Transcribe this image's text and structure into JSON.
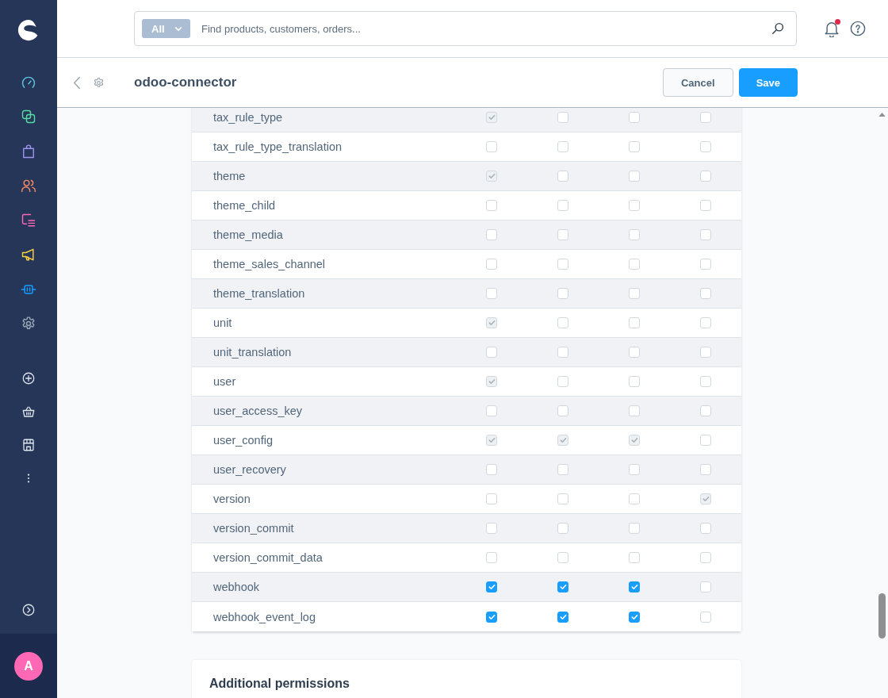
{
  "search": {
    "scope": "All",
    "placeholder": "Find products, customers, orders..."
  },
  "notifications": {
    "unread": true
  },
  "page_header": {
    "title": "odoo-connector",
    "buttons": [
      {
        "label": "Cancel",
        "kind": "secondary"
      },
      {
        "label": "Save",
        "kind": "primary"
      }
    ]
  },
  "table": {
    "rows": [
      {
        "name": "tax_rule_type",
        "permissions": [
          {
            "checked": true,
            "disabled": true
          },
          {
            "checked": false,
            "disabled": false
          },
          {
            "checked": false,
            "disabled": false
          },
          {
            "checked": false,
            "disabled": false
          }
        ]
      },
      {
        "name": "tax_rule_type_translation",
        "permissions": [
          {
            "checked": false,
            "disabled": false
          },
          {
            "checked": false,
            "disabled": false
          },
          {
            "checked": false,
            "disabled": false
          },
          {
            "checked": false,
            "disabled": false
          }
        ]
      },
      {
        "name": "theme",
        "permissions": [
          {
            "checked": true,
            "disabled": true
          },
          {
            "checked": false,
            "disabled": false
          },
          {
            "checked": false,
            "disabled": false
          },
          {
            "checked": false,
            "disabled": false
          }
        ]
      },
      {
        "name": "theme_child",
        "permissions": [
          {
            "checked": false,
            "disabled": false
          },
          {
            "checked": false,
            "disabled": false
          },
          {
            "checked": false,
            "disabled": false
          },
          {
            "checked": false,
            "disabled": false
          }
        ]
      },
      {
        "name": "theme_media",
        "permissions": [
          {
            "checked": false,
            "disabled": false
          },
          {
            "checked": false,
            "disabled": false
          },
          {
            "checked": false,
            "disabled": false
          },
          {
            "checked": false,
            "disabled": false
          }
        ]
      },
      {
        "name": "theme_sales_channel",
        "permissions": [
          {
            "checked": false,
            "disabled": false
          },
          {
            "checked": false,
            "disabled": false
          },
          {
            "checked": false,
            "disabled": false
          },
          {
            "checked": false,
            "disabled": false
          }
        ]
      },
      {
        "name": "theme_translation",
        "permissions": [
          {
            "checked": false,
            "disabled": false
          },
          {
            "checked": false,
            "disabled": false
          },
          {
            "checked": false,
            "disabled": false
          },
          {
            "checked": false,
            "disabled": false
          }
        ]
      },
      {
        "name": "unit",
        "permissions": [
          {
            "checked": true,
            "disabled": true
          },
          {
            "checked": false,
            "disabled": false
          },
          {
            "checked": false,
            "disabled": false
          },
          {
            "checked": false,
            "disabled": false
          }
        ]
      },
      {
        "name": "unit_translation",
        "permissions": [
          {
            "checked": false,
            "disabled": false
          },
          {
            "checked": false,
            "disabled": false
          },
          {
            "checked": false,
            "disabled": false
          },
          {
            "checked": false,
            "disabled": false
          }
        ]
      },
      {
        "name": "user",
        "permissions": [
          {
            "checked": true,
            "disabled": true
          },
          {
            "checked": false,
            "disabled": false
          },
          {
            "checked": false,
            "disabled": false
          },
          {
            "checked": false,
            "disabled": false
          }
        ]
      },
      {
        "name": "user_access_key",
        "permissions": [
          {
            "checked": false,
            "disabled": false
          },
          {
            "checked": false,
            "disabled": false
          },
          {
            "checked": false,
            "disabled": false
          },
          {
            "checked": false,
            "disabled": false
          }
        ]
      },
      {
        "name": "user_config",
        "permissions": [
          {
            "checked": true,
            "disabled": true
          },
          {
            "checked": true,
            "disabled": true
          },
          {
            "checked": true,
            "disabled": true
          },
          {
            "checked": false,
            "disabled": false
          }
        ]
      },
      {
        "name": "user_recovery",
        "permissions": [
          {
            "checked": false,
            "disabled": false
          },
          {
            "checked": false,
            "disabled": false
          },
          {
            "checked": false,
            "disabled": false
          },
          {
            "checked": false,
            "disabled": false
          }
        ]
      },
      {
        "name": "version",
        "permissions": [
          {
            "checked": false,
            "disabled": false
          },
          {
            "checked": false,
            "disabled": false
          },
          {
            "checked": false,
            "disabled": false
          },
          {
            "checked": true,
            "disabled": true
          }
        ]
      },
      {
        "name": "version_commit",
        "permissions": [
          {
            "checked": false,
            "disabled": false
          },
          {
            "checked": false,
            "disabled": false
          },
          {
            "checked": false,
            "disabled": false
          },
          {
            "checked": false,
            "disabled": false
          }
        ]
      },
      {
        "name": "version_commit_data",
        "permissions": [
          {
            "checked": false,
            "disabled": false
          },
          {
            "checked": false,
            "disabled": false
          },
          {
            "checked": false,
            "disabled": false
          },
          {
            "checked": false,
            "disabled": false
          }
        ]
      },
      {
        "name": "webhook",
        "permissions": [
          {
            "checked": true,
            "disabled": false
          },
          {
            "checked": true,
            "disabled": false
          },
          {
            "checked": true,
            "disabled": false
          },
          {
            "checked": false,
            "disabled": false
          }
        ]
      },
      {
        "name": "webhook_event_log",
        "permissions": [
          {
            "checked": true,
            "disabled": false
          },
          {
            "checked": true,
            "disabled": false
          },
          {
            "checked": true,
            "disabled": false
          },
          {
            "checked": false,
            "disabled": false
          }
        ]
      }
    ]
  },
  "additional_permissions": {
    "title": "Additional permissions"
  },
  "user": {
    "initial": "A"
  }
}
